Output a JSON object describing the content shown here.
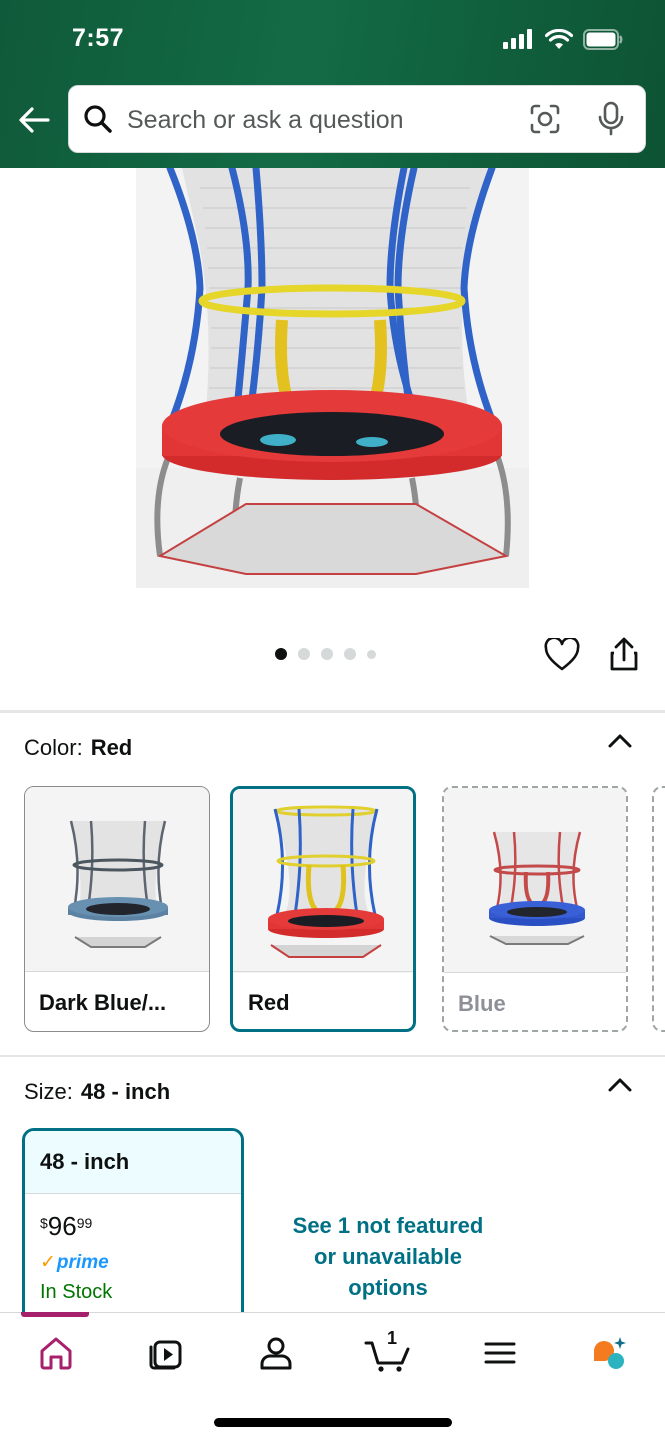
{
  "status_bar": {
    "time": "7:57"
  },
  "search": {
    "placeholder": "Search or ask a question"
  },
  "gallery": {
    "image_count": 5,
    "active_index": 0
  },
  "color_selector": {
    "label": "Color:",
    "selected_value": "Red",
    "options": [
      {
        "name": "Dark Blue/...",
        "state": "available"
      },
      {
        "name": "Red",
        "state": "selected"
      },
      {
        "name": "Blue",
        "state": "unavailable"
      }
    ]
  },
  "size_selector": {
    "label": "Size:",
    "selected_value": "48 - inch",
    "options": [
      {
        "name": "48 - inch",
        "price_symbol": "$",
        "price_whole": "96",
        "price_fraction": "99",
        "prime": "prime",
        "availability": "In Stock"
      }
    ],
    "see_more_line1": "See 1 not featured",
    "see_more_line2": "or unavailable",
    "see_more_line3": "options"
  },
  "bottom_nav": {
    "items": [
      "home-icon",
      "video-icon",
      "account-icon",
      "cart-icon",
      "menu-icon",
      "rufus-icon"
    ],
    "active": "home-icon",
    "cart_count": "1"
  },
  "colors": {
    "header_green": "#136b45",
    "accent_teal": "#007185",
    "nav_active": "#a7206c",
    "in_stock_green": "#007600",
    "prime_blue": "#1a98ff"
  }
}
